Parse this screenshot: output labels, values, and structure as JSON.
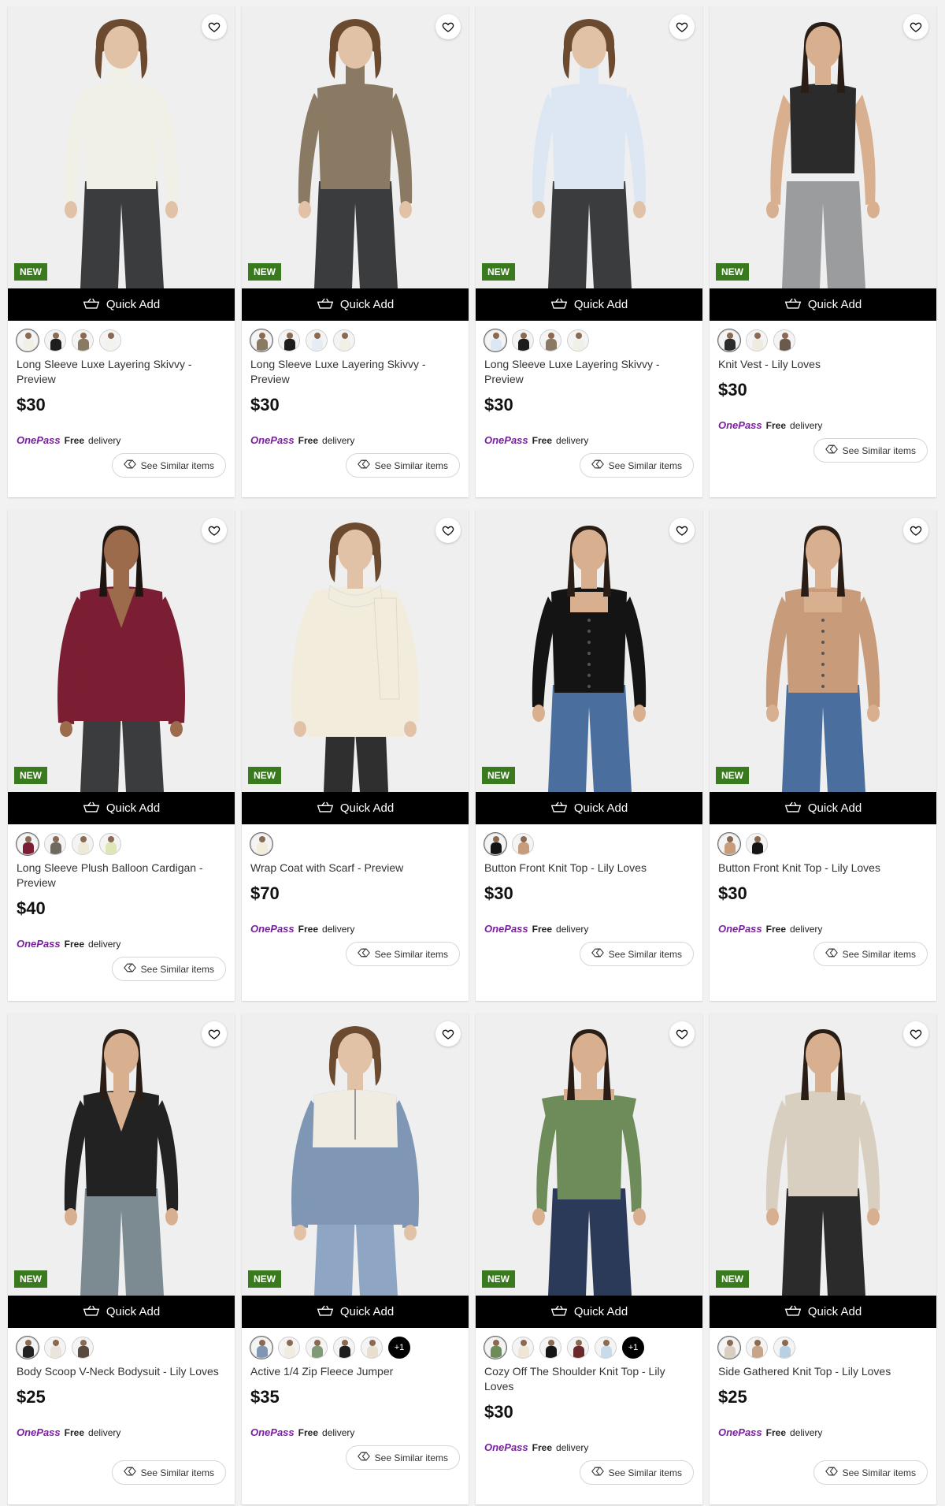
{
  "labels": {
    "new_badge": "NEW",
    "quick_add": "Quick Add",
    "onepass_logo": "OnePass",
    "free": "Free",
    "delivery": "delivery",
    "see_similar": "See Similar items"
  },
  "icons": {
    "favourite": "heart-outline-icon",
    "basket": "basket-icon",
    "similar": "tag-compare-icon"
  },
  "colors": {
    "badge_green": "#3a7a1f",
    "onepass_purple": "#7b1fa2",
    "quick_add_bg": "#000000"
  },
  "products": [
    {
      "name": "Long Sleeve Luxe Layering Skivvy - Preview",
      "price": "$30",
      "bg": "#efefef",
      "top": "#f1f0e6",
      "bottom": "#3a3c3e",
      "skin": "#e2c2a6",
      "hair": "#6b4a30",
      "style": "skivvy",
      "swatches": [
        "#f1f0e6",
        "#1d1d1d",
        "#8a7a63",
        "#f4f2ee"
      ],
      "more": ""
    },
    {
      "name": "Long Sleeve Luxe Layering Skivvy - Preview",
      "price": "$30",
      "bg": "#efefef",
      "top": "#8a7a63",
      "bottom": "#3a3c3e",
      "skin": "#e2c2a6",
      "hair": "#6b4a30",
      "style": "skivvy",
      "swatches": [
        "#8a7a63",
        "#1d1d1d",
        "#e6ecf3",
        "#f1f0e6"
      ],
      "more": ""
    },
    {
      "name": "Long Sleeve Luxe Layering Skivvy - Preview",
      "price": "$30",
      "bg": "#efefef",
      "top": "#dce7f3",
      "bottom": "#3a3c3e",
      "skin": "#e2c2a6",
      "hair": "#6b4a30",
      "style": "skivvy",
      "swatches": [
        "#dce7f3",
        "#1d1d1d",
        "#8a7a63",
        "#f1f0e6"
      ],
      "more": ""
    },
    {
      "name": "Knit Vest - Lily Loves",
      "price": "$30",
      "bg": "#efefef",
      "top": "#2b2b2b",
      "bottom": "#9a9c9e",
      "skin": "#d9b08f",
      "hair": "#2a1d16",
      "style": "vest",
      "swatches": [
        "#2b2b2b",
        "#f0ebe0",
        "#6b5a4b"
      ],
      "more": ""
    },
    {
      "name": "Long Sleeve Plush Balloon Cardigan - Preview",
      "price": "$40",
      "bg": "#efefef",
      "top": "#7b1e33",
      "bottom": "#3a3c3e",
      "skin": "#9b6b4c",
      "hair": "#1d1410",
      "style": "cardigan",
      "swatches": [
        "#7b1e33",
        "#6e6a60",
        "#efe9d8",
        "#dfe5b5"
      ],
      "more": ""
    },
    {
      "name": "Wrap Coat with Scarf - Preview",
      "price": "$70",
      "bg": "#efefef",
      "top": "#f2ecdd",
      "bottom": "#2f2f2f",
      "skin": "#e2c2a6",
      "hair": "#6b4a30",
      "style": "coat",
      "swatches": [
        "#f2ecdd"
      ],
      "more": ""
    },
    {
      "name": "Button Front Knit Top - Lily Loves",
      "price": "$30",
      "bg": "#efefef",
      "top": "#141414",
      "bottom": "#4a6f9e",
      "skin": "#d9b08f",
      "hair": "#2a1d16",
      "style": "square",
      "swatches": [
        "#141414",
        "#c89b7b"
      ],
      "more": ""
    },
    {
      "name": "Button Front Knit Top - Lily Loves",
      "price": "$30",
      "bg": "#efefef",
      "top": "#c89b7b",
      "bottom": "#4a6f9e",
      "skin": "#d9b08f",
      "hair": "#2a1d16",
      "style": "square",
      "swatches": [
        "#c89b7b",
        "#141414"
      ],
      "more": ""
    },
    {
      "name": "Body Scoop V-Neck Bodysuit - Lily Loves",
      "price": "$25",
      "bg": "#efefef",
      "top": "#222222",
      "bottom": "#7c8a92",
      "skin": "#d9b08f",
      "hair": "#2a1d16",
      "style": "vneck",
      "swatches": [
        "#222222",
        "#e9e4dc",
        "#5a4a40"
      ],
      "more": ""
    },
    {
      "name": "Active 1/4 Zip Fleece Jumper",
      "price": "$35",
      "bg": "#efefef",
      "top": "#7f97b5",
      "bottom": "#8ea6c4",
      "skin": "#e2c2a6",
      "hair": "#6b4a30",
      "style": "zip",
      "swatches": [
        "#7f97b5",
        "#f0ece2",
        "#7f9a74",
        "#1d1d1d",
        "#e8dfcf"
      ],
      "more": "+1"
    },
    {
      "name": "Cozy Off The Shoulder Knit Top - Lily Loves",
      "price": "$30",
      "bg": "#efefef",
      "top": "#6d8c5a",
      "bottom": "#2c3a5a",
      "skin": "#d9b08f",
      "hair": "#2a1d16",
      "style": "offshoulder",
      "swatches": [
        "#6d8c5a",
        "#efe6d6",
        "#141414",
        "#6b2a2a",
        "#c9dbe9"
      ],
      "more": "+1"
    },
    {
      "name": "Side Gathered Knit Top - Lily Loves",
      "price": "$25",
      "bg": "#efefef",
      "top": "#d9cfc0",
      "bottom": "#2b2b2b",
      "skin": "#d9b08f",
      "hair": "#2a1d16",
      "style": "fitted",
      "swatches": [
        "#d9cfc0",
        "#c8a488",
        "#b8d0e2"
      ],
      "more": ""
    }
  ]
}
